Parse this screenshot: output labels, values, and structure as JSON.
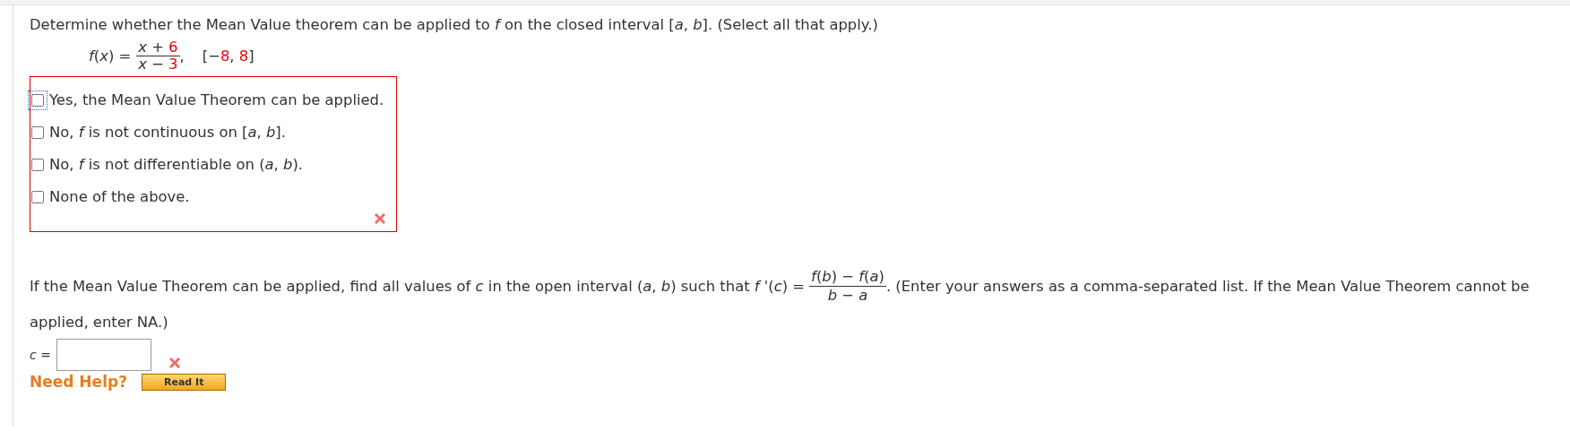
{
  "question": {
    "prompt": "Determine whether the Mean Value theorem can be applied to *f* on the closed interval [*a*, *b*]. (Select all that apply.)",
    "function": {
      "lhs": "*f*(*x*) =",
      "numerator": [
        {
          "kind": "plain",
          "text": "*x* + "
        },
        {
          "kind": "param",
          "text": "6"
        }
      ],
      "denominator": [
        {
          "kind": "plain",
          "text": "*x* − "
        },
        {
          "kind": "param",
          "text": "3"
        }
      ],
      "comma": ","
    },
    "interval": [
      {
        "kind": "plain",
        "text": "[−"
      },
      {
        "kind": "param",
        "text": "8"
      },
      {
        "kind": "plain",
        "text": ", "
      },
      {
        "kind": "param",
        "text": "8"
      },
      {
        "kind": "plain",
        "text": "]"
      }
    ],
    "options": [
      {
        "label": "Yes, the Mean Value Theorem can be applied.",
        "checked": false,
        "focused": true
      },
      {
        "label": "No, *f* is not continuous on [*a*, *b*].",
        "checked": false,
        "focused": false
      },
      {
        "label": "No, *f* is not differentiable on (*a*, *b*).",
        "checked": false,
        "focused": false
      },
      {
        "label": "None of the above.",
        "checked": false,
        "focused": false
      }
    ],
    "incorrect": true
  },
  "part2": {
    "text_before": "If the Mean Value Theorem can be applied, find all values of *c* in the open interval (*a*, *b*) such that *f* '(*c*) =",
    "fraction": {
      "numerator": "*f*(*b*) − *f*(*a*)",
      "denominator": "*b* − *a*"
    },
    "text_after": ". (Enter your answers as a comma-separated list. If the Mean Value Theorem cannot be",
    "text_continued": "applied, enter NA.)",
    "answer_label": "*c* =",
    "incorrect": true
  },
  "help": {
    "label": "Need Help?",
    "buttons": [
      "Read It"
    ]
  }
}
